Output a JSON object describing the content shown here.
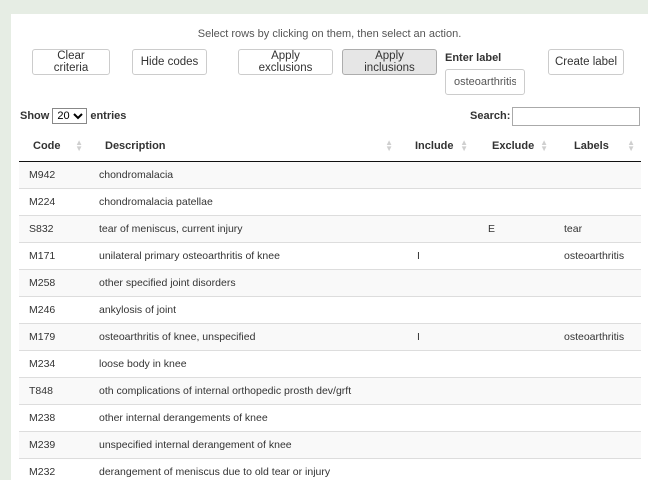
{
  "instructions": "Select rows by clicking on them, then select an action.",
  "buttons": {
    "clear": "Clear criteria",
    "hide": "Hide codes",
    "exclusions": "Apply exclusions",
    "inclusions": "Apply inclusions",
    "create": "Create label"
  },
  "label_box": {
    "title": "Enter label",
    "value": "osteoarthritis"
  },
  "length": {
    "show": "Show",
    "entries": "entries",
    "selected": "20"
  },
  "search": {
    "label": "Search:",
    "value": ""
  },
  "columns": [
    "Code",
    "Description",
    "Include",
    "Exclude",
    "Labels"
  ],
  "rows": [
    {
      "code": "M942",
      "desc": "chondromalacia",
      "include": "",
      "exclude": "",
      "labels": ""
    },
    {
      "code": "M224",
      "desc": "chondromalacia patellae",
      "include": "",
      "exclude": "",
      "labels": ""
    },
    {
      "code": "S832",
      "desc": "tear of meniscus, current injury",
      "include": "",
      "exclude": "E",
      "labels": "tear"
    },
    {
      "code": "M171",
      "desc": "unilateral primary osteoarthritis of knee",
      "include": "I",
      "exclude": "",
      "labels": "osteoarthritis"
    },
    {
      "code": "M258",
      "desc": "other specified joint disorders",
      "include": "",
      "exclude": "",
      "labels": ""
    },
    {
      "code": "M246",
      "desc": "ankylosis of joint",
      "include": "",
      "exclude": "",
      "labels": ""
    },
    {
      "code": "M179",
      "desc": "osteoarthritis of knee, unspecified",
      "include": "I",
      "exclude": "",
      "labels": "osteoarthritis"
    },
    {
      "code": "M234",
      "desc": "loose body in knee",
      "include": "",
      "exclude": "",
      "labels": ""
    },
    {
      "code": "T848",
      "desc": "oth complications of internal orthopedic prosth dev/grft",
      "include": "",
      "exclude": "",
      "labels": ""
    },
    {
      "code": "M238",
      "desc": "other internal derangements of knee",
      "include": "",
      "exclude": "",
      "labels": ""
    },
    {
      "code": "M239",
      "desc": "unspecified internal derangement of knee",
      "include": "",
      "exclude": "",
      "labels": ""
    },
    {
      "code": "M232",
      "desc": "derangement of meniscus due to old tear or injury",
      "include": "",
      "exclude": "",
      "labels": ""
    }
  ]
}
